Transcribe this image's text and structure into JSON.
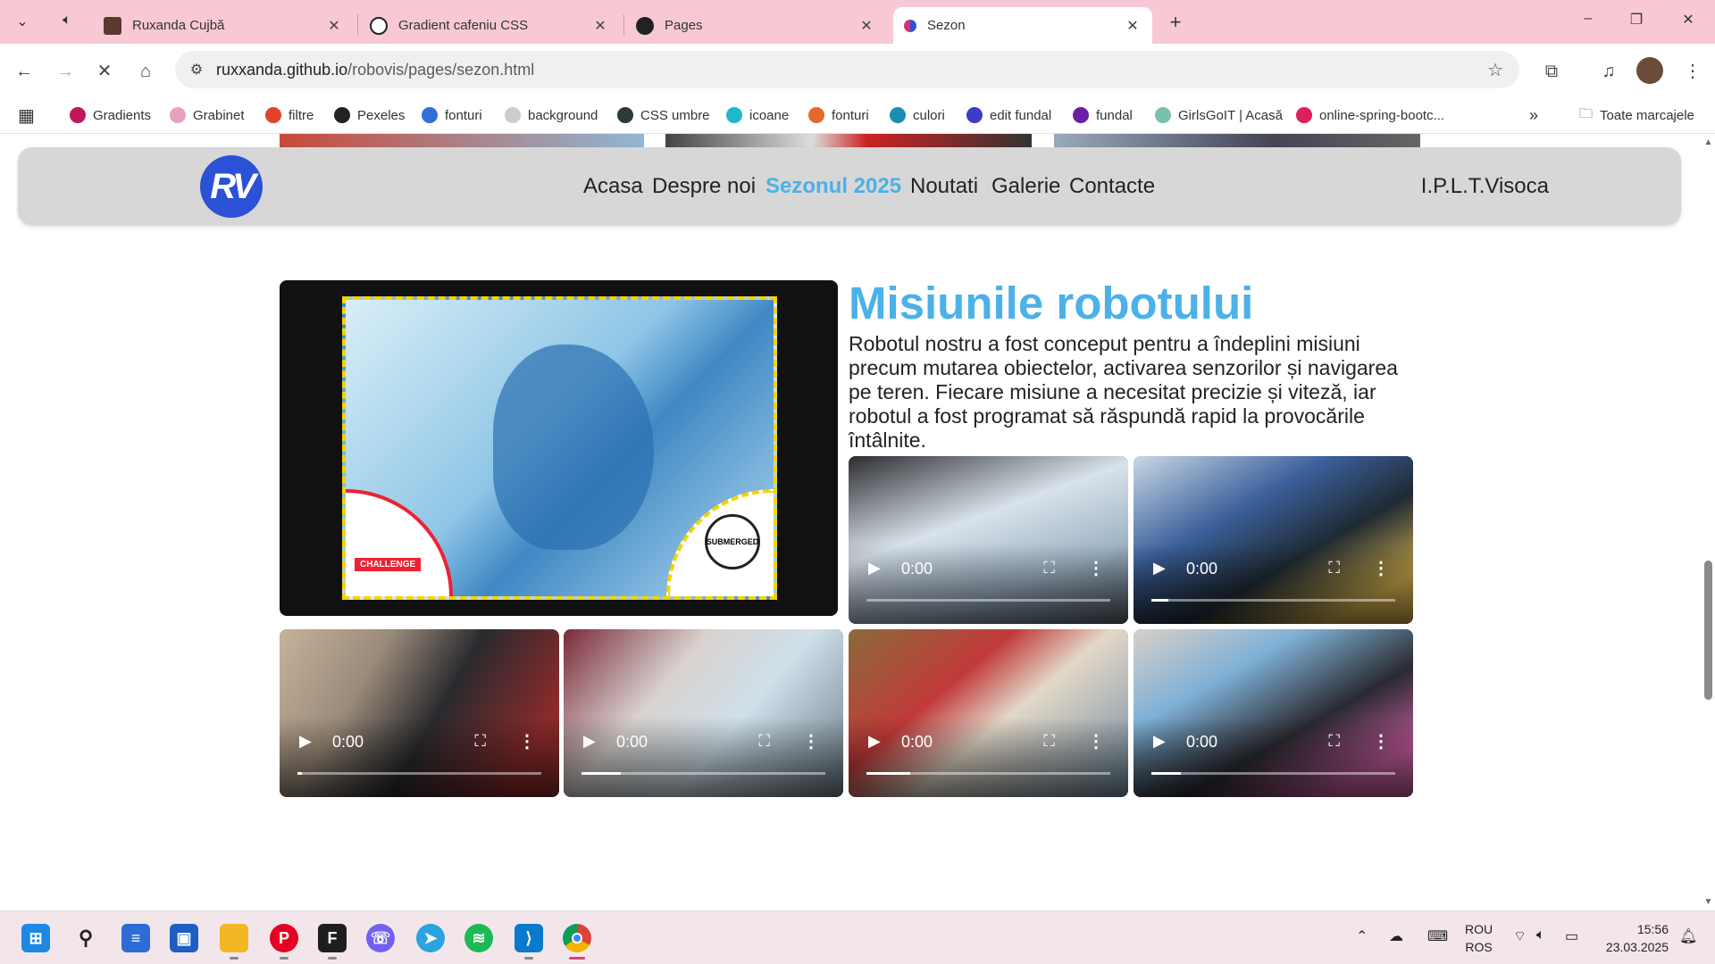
{
  "browser": {
    "tabs": [
      {
        "title": "Ruxanda Cujbă",
        "icon": "avatar-photo"
      },
      {
        "title": "Gradient cafeniu CSS",
        "icon": "openai-icon"
      },
      {
        "title": "Pages",
        "icon": "github-icon"
      },
      {
        "title": "Sezon",
        "icon": "site-favicon",
        "active": true
      }
    ],
    "url_host": "ruxxanda.github.io",
    "url_path": "/robovis/pages/sezon.html",
    "bookmarks": [
      {
        "label": "Gradients",
        "color": "#c0185b"
      },
      {
        "label": "Grabinet",
        "color": "#e8a0c0"
      },
      {
        "label": "filtre",
        "color": "#e0452c"
      },
      {
        "label": "Pexeles",
        "color": "#222222"
      },
      {
        "label": "fonturi",
        "color": "#2f6fd6"
      },
      {
        "label": "background",
        "color": "#cccccc"
      },
      {
        "label": "CSS umbre",
        "color": "#2b3a3a"
      },
      {
        "label": "icoane",
        "color": "#1fb7c9"
      },
      {
        "label": "fonturi",
        "color": "#e36a2a"
      },
      {
        "label": "culori",
        "color": "#1a8fb0"
      },
      {
        "label": "edit fundal",
        "color": "#3c3cc8"
      },
      {
        "label": "fundal",
        "color": "#6b1fa6"
      },
      {
        "label": "GirlsGoIT | Acasă",
        "color": "#7ac0b0"
      },
      {
        "label": "online-spring-bootc...",
        "color": "#e01e5a"
      }
    ],
    "all_bookmarks": "Toate marcajele"
  },
  "site": {
    "logo": "RV",
    "nav": [
      "Acasa",
      "Despre noi",
      "Sezonul 2025",
      "Noutati",
      "Galerie",
      "Contacte"
    ],
    "active_nav": "Sezonul 2025",
    "school": "I.P.L.T.Visoca",
    "title": "Misiunile robotului",
    "description": "Robotul nostru a fost conceput pentru a îndeplini misiuni precum mutarea obiectelor, activarea senzorilor și navigarea pe teren. Fiecare misiune a necesitat precizie și viteză, iar robotul a fost programat să răspundă rapid la provocările întâlnite.",
    "image_labels": {
      "challenge": "CHALLENGE",
      "submerged": "SUBMERGED"
    },
    "videos": [
      {
        "time": "0:00",
        "progress": 0.0
      },
      {
        "time": "0:00",
        "progress": 0.07
      },
      {
        "time": "0:00",
        "progress": 0.02
      },
      {
        "time": "0:00",
        "progress": 0.16
      },
      {
        "time": "0:00",
        "progress": 0.18
      },
      {
        "time": "0:00",
        "progress": 0.12
      }
    ]
  },
  "taskbar": {
    "lang": [
      "ROU",
      "ROS"
    ],
    "time": "15:56",
    "date": "23.03.2025"
  }
}
